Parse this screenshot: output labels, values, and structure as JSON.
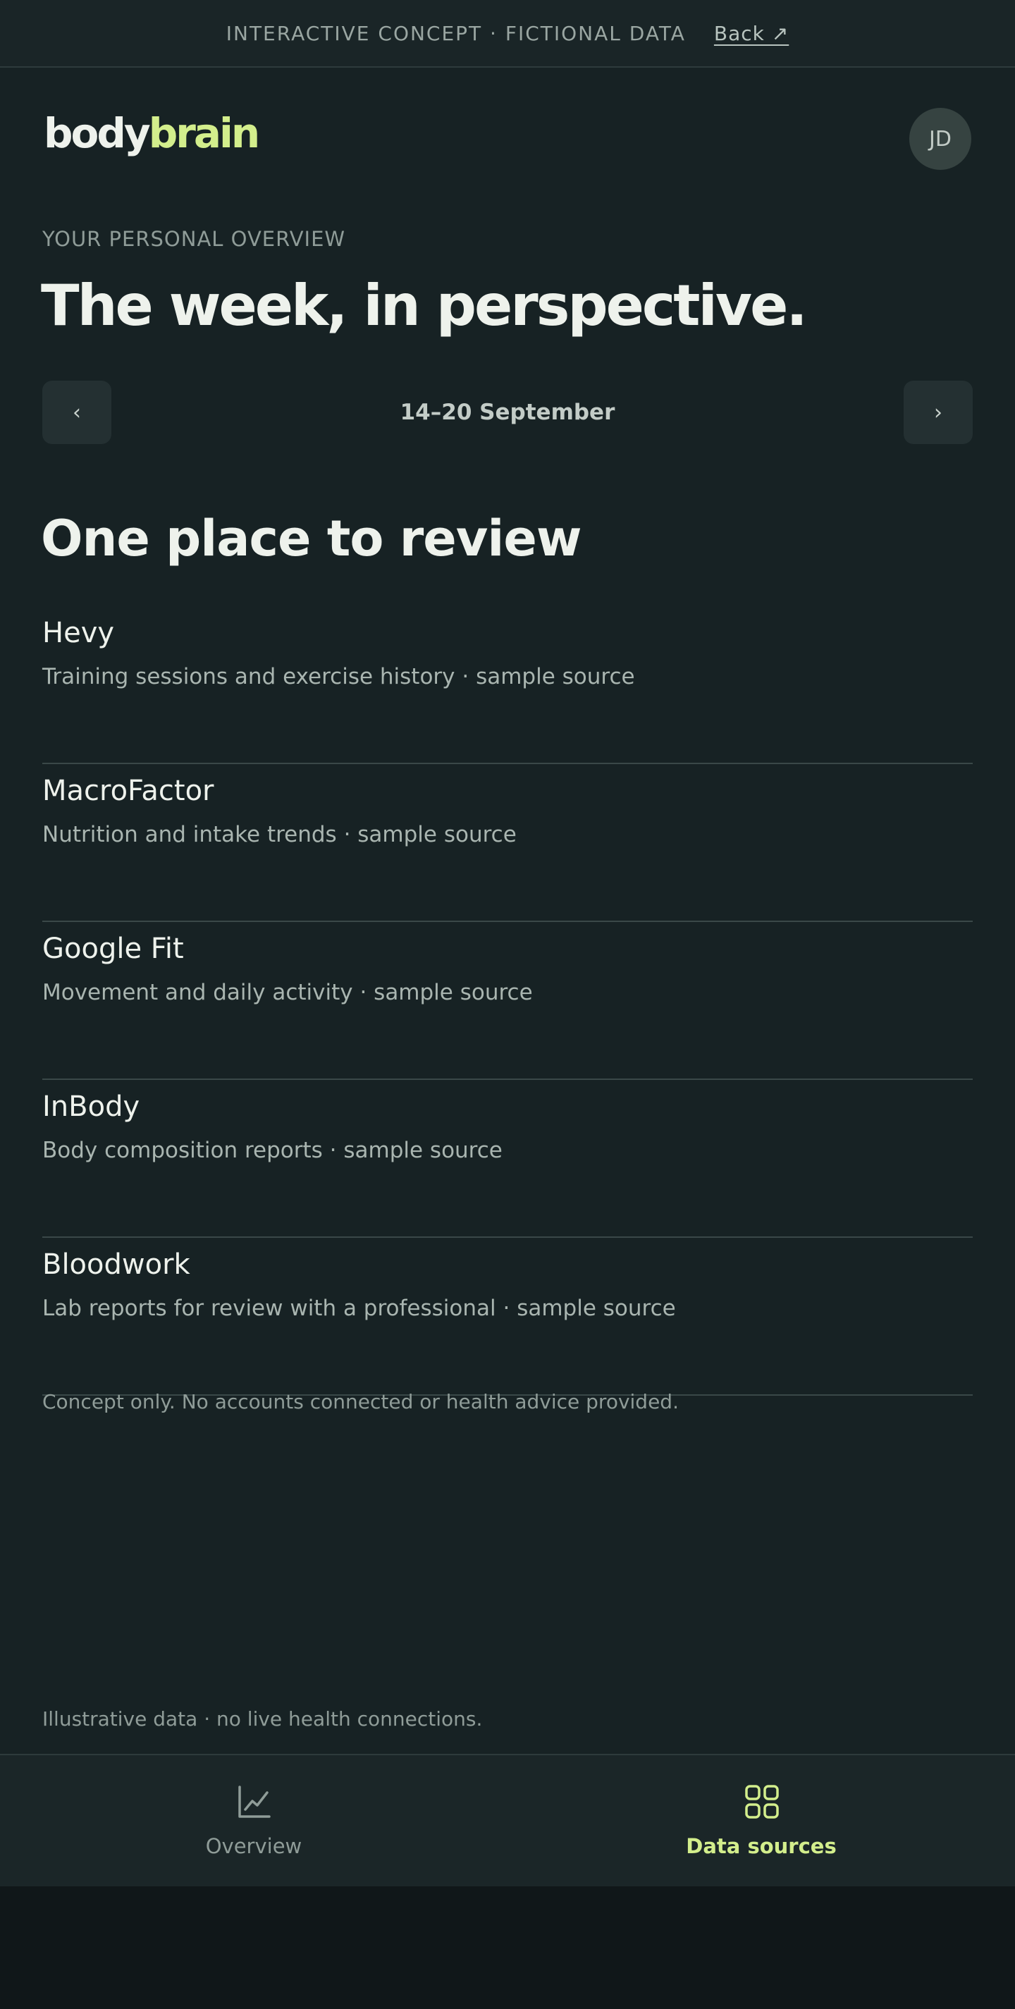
{
  "banner": {
    "label": "INTERACTIVE CONCEPT · FICTIONAL DATA",
    "back_link": "Back ↗"
  },
  "brand": {
    "logo_part1": "body",
    "logo_part2": "brain",
    "accent_color": "#d3ee8c"
  },
  "user": {
    "initials": "JD"
  },
  "hero": {
    "eyebrow": "YOUR PERSONAL OVERVIEW",
    "title": "The week, in perspective."
  },
  "week_nav": {
    "prev_label": "‹",
    "range": "14–20 September",
    "next_label": "›"
  },
  "sources": {
    "title": "One place to review",
    "items": [
      {
        "name": "Hevy",
        "description": "Training sessions and exercise history · sample source"
      },
      {
        "name": "MacroFactor",
        "description": "Nutrition and intake trends · sample source"
      },
      {
        "name": "Google Fit",
        "description": "Movement and daily activity · sample source"
      },
      {
        "name": "InBody",
        "description": "Body composition reports · sample source"
      },
      {
        "name": "Bloodwork",
        "description": "Lab reports for review with a professional · sample source"
      }
    ],
    "disclaimer": "Concept only. No accounts connected or health advice provided."
  },
  "footer": {
    "note": "Illustrative data · no live health connections."
  },
  "bottom_nav": {
    "tabs": [
      {
        "label": "Overview",
        "icon": "line-chart-icon",
        "active": false
      },
      {
        "label": "Data sources",
        "icon": "grid-icon",
        "active": true
      }
    ]
  }
}
